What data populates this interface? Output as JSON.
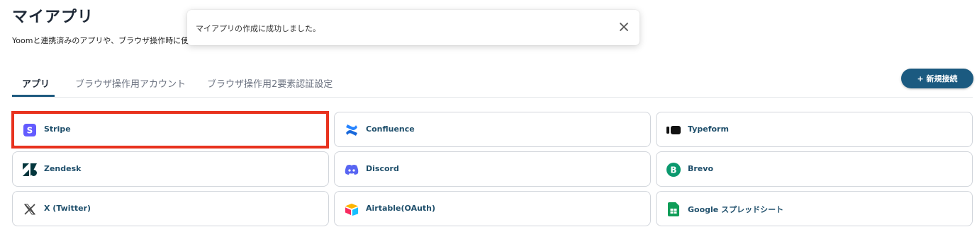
{
  "page": {
    "title": "マイアプリ",
    "description": "Yoomと連携済みのアプリや、ブラウザ操作時に使"
  },
  "toast": {
    "message": "マイアプリの作成に成功しました。",
    "close_icon": "close-icon"
  },
  "tabs": [
    {
      "label": "アプリ",
      "active": true
    },
    {
      "label": "ブラウザ操作用アカウント",
      "active": false
    },
    {
      "label": "ブラウザ操作用2要素認証設定",
      "active": false
    }
  ],
  "new_button": {
    "label": "+ 新規接続"
  },
  "apps": [
    {
      "name": "Stripe",
      "icon": "stripe-icon"
    },
    {
      "name": "Confluence",
      "icon": "confluence-icon"
    },
    {
      "name": "Typeform",
      "icon": "typeform-icon"
    },
    {
      "name": "Zendesk",
      "icon": "zendesk-icon"
    },
    {
      "name": "Discord",
      "icon": "discord-icon"
    },
    {
      "name": "Brevo",
      "icon": "brevo-icon"
    },
    {
      "name": "X (Twitter)",
      "icon": "x-twitter-icon"
    },
    {
      "name": "Airtable(OAuth)",
      "icon": "airtable-icon"
    },
    {
      "name": "Google スプレッドシート",
      "icon": "google-sheets-icon"
    }
  ],
  "colors": {
    "accent": "#1b5a80",
    "highlight": "#e8321e"
  }
}
